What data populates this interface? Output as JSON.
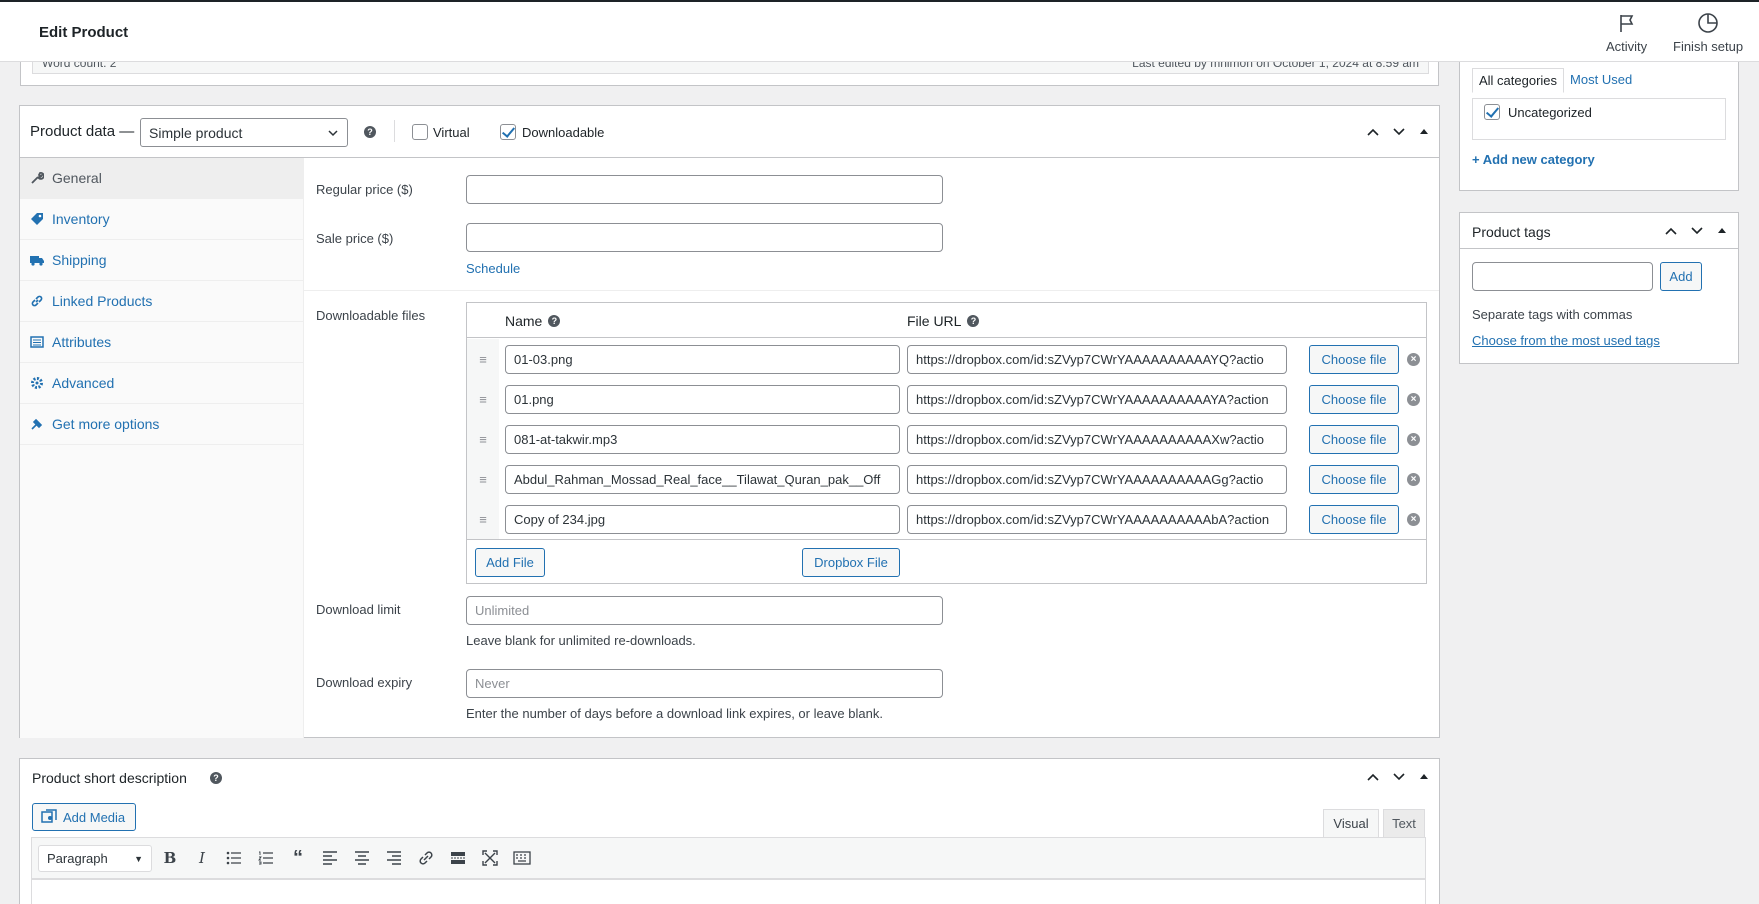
{
  "header": {
    "title": "Edit Product",
    "activity_label": "Activity",
    "finish_setup_label": "Finish setup"
  },
  "wordcount": {
    "label": "Word count: 2",
    "last_edited": "Last edited by mnimon on October 1, 2024 at 8:59 am"
  },
  "product_data": {
    "label": "Product data —",
    "type_value": "Simple product",
    "virtual_label": "Virtual",
    "virtual_checked": false,
    "downloadable_label": "Downloadable",
    "downloadable_checked": true,
    "tabs": [
      {
        "label": "General",
        "icon": "wrench-icon"
      },
      {
        "label": "Inventory",
        "icon": "tag-icon"
      },
      {
        "label": "Shipping",
        "icon": "truck-icon"
      },
      {
        "label": "Linked Products",
        "icon": "link-icon"
      },
      {
        "label": "Attributes",
        "icon": "list-icon"
      },
      {
        "label": "Advanced",
        "icon": "gear-icon"
      },
      {
        "label": "Get more options",
        "icon": "plugin-icon"
      }
    ],
    "regular_price_label": "Regular price ($)",
    "regular_price_value": "",
    "sale_price_label": "Sale price ($)",
    "sale_price_value": "",
    "schedule_link": "Schedule",
    "downloadable_files_label": "Downloadable files",
    "col_name": "Name",
    "col_url": "File URL",
    "files": [
      {
        "name": "01-03.png",
        "url": "https://dropbox.com/id:sZVyp7CWrYAAAAAAAAAAYQ?actio",
        "choose": "Choose file"
      },
      {
        "name": "01.png",
        "url": "https://dropbox.com/id:sZVyp7CWrYAAAAAAAAAAYA?action",
        "choose": "Choose file"
      },
      {
        "name": "081-at-takwir.mp3",
        "url": "https://dropbox.com/id:sZVyp7CWrYAAAAAAAAAAXw?actio",
        "choose": "Choose file"
      },
      {
        "name": "Abdul_Rahman_Mossad_Real_face__Tilawat_Quran_pak__Off",
        "url": "https://dropbox.com/id:sZVyp7CWrYAAAAAAAAAAGg?actio",
        "choose": "Choose file"
      },
      {
        "name": "Copy of 234.jpg",
        "url": "https://dropbox.com/id:sZVyp7CWrYAAAAAAAAAAbA?action",
        "choose": "Choose file"
      }
    ],
    "add_file_button": "Add File",
    "dropbox_file_button": "Dropbox File",
    "download_limit_label": "Download limit",
    "download_limit_placeholder": "Unlimited",
    "download_limit_desc": "Leave blank for unlimited re-downloads.",
    "download_expiry_label": "Download expiry",
    "download_expiry_placeholder": "Never",
    "download_expiry_desc": "Enter the number of days before a download link expires, or leave blank."
  },
  "categories": {
    "tab_all": "All categories",
    "tab_most_used": "Most Used",
    "items": [
      {
        "label": "Uncategorized",
        "checked": true
      }
    ],
    "add_new_link": "+ Add new category"
  },
  "tags": {
    "title": "Product tags",
    "input_value": "",
    "add_button": "Add",
    "separate_hint": "Separate tags with commas",
    "choose_link": "Choose from the most used tags"
  },
  "short_description": {
    "title": "Product short description",
    "add_media_button": "Add Media",
    "visual_tab": "Visual",
    "text_tab": "Text",
    "format_select": "Paragraph"
  },
  "colors": {
    "accent": "#2271b1",
    "border": "#c3c4c7",
    "background": "#f0f0f1"
  }
}
